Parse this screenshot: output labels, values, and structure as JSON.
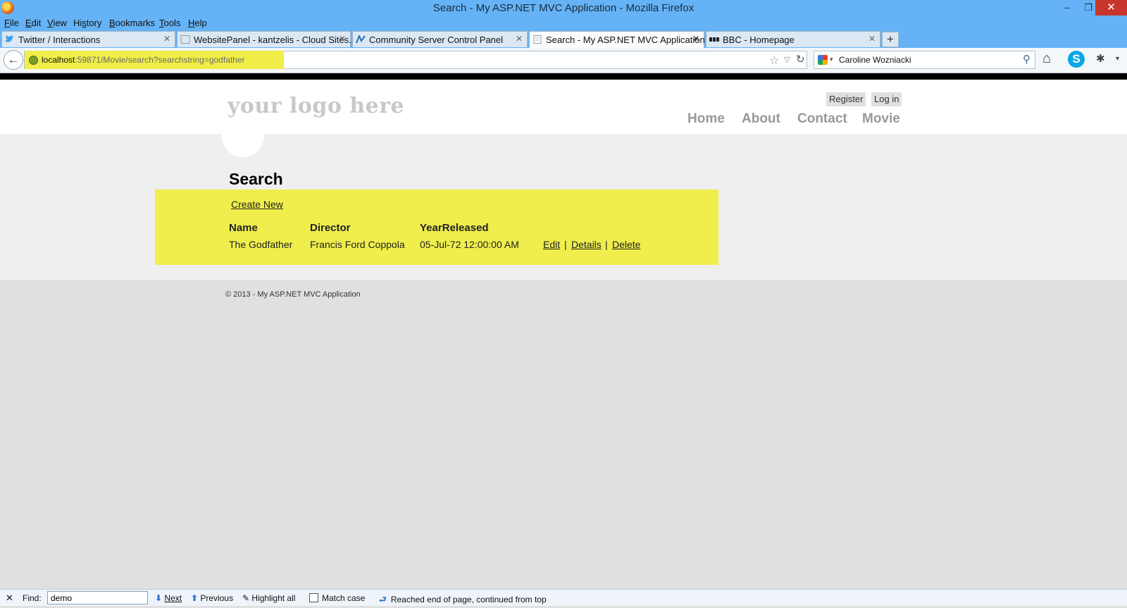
{
  "window": {
    "title": "Search - My ASP.NET MVC Application - Mozilla Firefox",
    "controls": {
      "minimize": "–",
      "maximize": "❐",
      "close": "✕"
    }
  },
  "menu": [
    {
      "pre": "",
      "acc": "F",
      "post": "ile"
    },
    {
      "pre": "",
      "acc": "E",
      "post": "dit"
    },
    {
      "pre": "",
      "acc": "V",
      "post": "iew"
    },
    {
      "pre": "Hi",
      "acc": "s",
      "post": "tory"
    },
    {
      "pre": "",
      "acc": "B",
      "post": "ookmarks"
    },
    {
      "pre": "",
      "acc": "T",
      "post": "ools"
    },
    {
      "pre": "",
      "acc": "H",
      "post": "elp"
    }
  ],
  "tabs": [
    {
      "label": "Twitter / Interactions",
      "close": "✕",
      "icon": "twitter-icon"
    },
    {
      "label": "WebsitePanel - kantzelis - Cloud Sites...",
      "close": "✕",
      "icon": "blank-page-icon"
    },
    {
      "label": "Community Server Control Panel",
      "close": "✕",
      "icon": "community-server-icon"
    },
    {
      "label": "Search - My ASP.NET MVC Application",
      "close": "✕",
      "icon": "page-icon"
    },
    {
      "label": "BBC - Homepage",
      "close": "✕",
      "icon": "bbc-icon"
    }
  ],
  "new_tab": "+",
  "nav": {
    "back": "←",
    "url_host": "localhost",
    "url_path": ":59871/Movie/search?searchstring=godfather",
    "star": "☆",
    "dropdown": "▽",
    "reload": "↻",
    "search_value": "Caroline Wozniacki",
    "search_drop": "▾",
    "search_go": "⚲",
    "home": "⌂",
    "skype": "S",
    "addon": "✱",
    "menu_drop": "▾"
  },
  "site": {
    "logo": "your logo here",
    "auth_links": {
      "register": "Register",
      "login": "Log in"
    },
    "main_nav": {
      "home": "Home",
      "about": "About",
      "contact": "Contact",
      "movie": "Movie"
    }
  },
  "content": {
    "title": "Search",
    "create_new": "Create New",
    "headers": {
      "name": "Name",
      "director": "Director",
      "year": "YearReleased"
    },
    "rows": [
      {
        "name": "The Godfather",
        "director": "Francis Ford Coppola",
        "year": "05-Jul-72 12:00:00 AM",
        "edit": "Edit",
        "details": "Details",
        "delete": "Delete",
        "sep": "|"
      }
    ]
  },
  "footer": "© 2013 - My ASP.NET MVC Application",
  "findbar": {
    "close": "✕",
    "label": "Find:",
    "value": "demo",
    "next": "Next",
    "previous": "Previous",
    "highlight_all": "Highlight all",
    "match_case": "Match case",
    "status": "Reached end of page, continued from top",
    "next_arrow": "⬇",
    "prev_arrow": "⬆",
    "highlight_icon": "✎",
    "status_icon": "⮐"
  },
  "colors": {
    "titlebar": "#65b3f6",
    "highlight": "#efee4c",
    "close_button": "#c7362c"
  }
}
